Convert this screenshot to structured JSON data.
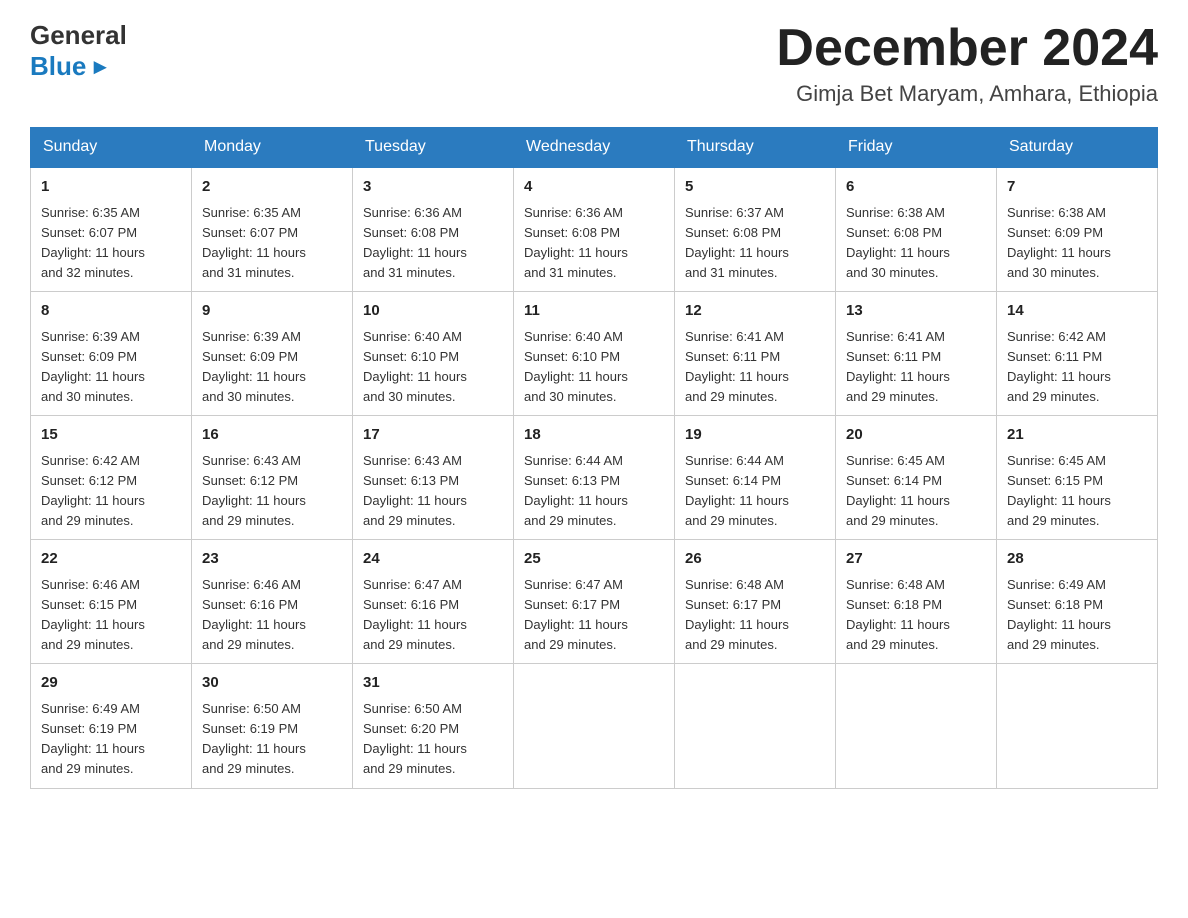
{
  "header": {
    "logo": {
      "general": "General",
      "blue": "Blue",
      "arrow": "▶"
    },
    "title": "December 2024",
    "location": "Gimja Bet Maryam, Amhara, Ethiopia"
  },
  "calendar": {
    "days_of_week": [
      "Sunday",
      "Monday",
      "Tuesday",
      "Wednesday",
      "Thursday",
      "Friday",
      "Saturday"
    ],
    "weeks": [
      [
        {
          "day": "1",
          "sunrise": "6:35 AM",
          "sunset": "6:07 PM",
          "daylight": "11 hours and 32 minutes."
        },
        {
          "day": "2",
          "sunrise": "6:35 AM",
          "sunset": "6:07 PM",
          "daylight": "11 hours and 31 minutes."
        },
        {
          "day": "3",
          "sunrise": "6:36 AM",
          "sunset": "6:08 PM",
          "daylight": "11 hours and 31 minutes."
        },
        {
          "day": "4",
          "sunrise": "6:36 AM",
          "sunset": "6:08 PM",
          "daylight": "11 hours and 31 minutes."
        },
        {
          "day": "5",
          "sunrise": "6:37 AM",
          "sunset": "6:08 PM",
          "daylight": "11 hours and 31 minutes."
        },
        {
          "day": "6",
          "sunrise": "6:38 AM",
          "sunset": "6:08 PM",
          "daylight": "11 hours and 30 minutes."
        },
        {
          "day": "7",
          "sunrise": "6:38 AM",
          "sunset": "6:09 PM",
          "daylight": "11 hours and 30 minutes."
        }
      ],
      [
        {
          "day": "8",
          "sunrise": "6:39 AM",
          "sunset": "6:09 PM",
          "daylight": "11 hours and 30 minutes."
        },
        {
          "day": "9",
          "sunrise": "6:39 AM",
          "sunset": "6:09 PM",
          "daylight": "11 hours and 30 minutes."
        },
        {
          "day": "10",
          "sunrise": "6:40 AM",
          "sunset": "6:10 PM",
          "daylight": "11 hours and 30 minutes."
        },
        {
          "day": "11",
          "sunrise": "6:40 AM",
          "sunset": "6:10 PM",
          "daylight": "11 hours and 30 minutes."
        },
        {
          "day": "12",
          "sunrise": "6:41 AM",
          "sunset": "6:11 PM",
          "daylight": "11 hours and 29 minutes."
        },
        {
          "day": "13",
          "sunrise": "6:41 AM",
          "sunset": "6:11 PM",
          "daylight": "11 hours and 29 minutes."
        },
        {
          "day": "14",
          "sunrise": "6:42 AM",
          "sunset": "6:11 PM",
          "daylight": "11 hours and 29 minutes."
        }
      ],
      [
        {
          "day": "15",
          "sunrise": "6:42 AM",
          "sunset": "6:12 PM",
          "daylight": "11 hours and 29 minutes."
        },
        {
          "day": "16",
          "sunrise": "6:43 AM",
          "sunset": "6:12 PM",
          "daylight": "11 hours and 29 minutes."
        },
        {
          "day": "17",
          "sunrise": "6:43 AM",
          "sunset": "6:13 PM",
          "daylight": "11 hours and 29 minutes."
        },
        {
          "day": "18",
          "sunrise": "6:44 AM",
          "sunset": "6:13 PM",
          "daylight": "11 hours and 29 minutes."
        },
        {
          "day": "19",
          "sunrise": "6:44 AM",
          "sunset": "6:14 PM",
          "daylight": "11 hours and 29 minutes."
        },
        {
          "day": "20",
          "sunrise": "6:45 AM",
          "sunset": "6:14 PM",
          "daylight": "11 hours and 29 minutes."
        },
        {
          "day": "21",
          "sunrise": "6:45 AM",
          "sunset": "6:15 PM",
          "daylight": "11 hours and 29 minutes."
        }
      ],
      [
        {
          "day": "22",
          "sunrise": "6:46 AM",
          "sunset": "6:15 PM",
          "daylight": "11 hours and 29 minutes."
        },
        {
          "day": "23",
          "sunrise": "6:46 AM",
          "sunset": "6:16 PM",
          "daylight": "11 hours and 29 minutes."
        },
        {
          "day": "24",
          "sunrise": "6:47 AM",
          "sunset": "6:16 PM",
          "daylight": "11 hours and 29 minutes."
        },
        {
          "day": "25",
          "sunrise": "6:47 AM",
          "sunset": "6:17 PM",
          "daylight": "11 hours and 29 minutes."
        },
        {
          "day": "26",
          "sunrise": "6:48 AM",
          "sunset": "6:17 PM",
          "daylight": "11 hours and 29 minutes."
        },
        {
          "day": "27",
          "sunrise": "6:48 AM",
          "sunset": "6:18 PM",
          "daylight": "11 hours and 29 minutes."
        },
        {
          "day": "28",
          "sunrise": "6:49 AM",
          "sunset": "6:18 PM",
          "daylight": "11 hours and 29 minutes."
        }
      ],
      [
        {
          "day": "29",
          "sunrise": "6:49 AM",
          "sunset": "6:19 PM",
          "daylight": "11 hours and 29 minutes."
        },
        {
          "day": "30",
          "sunrise": "6:50 AM",
          "sunset": "6:19 PM",
          "daylight": "11 hours and 29 minutes."
        },
        {
          "day": "31",
          "sunrise": "6:50 AM",
          "sunset": "6:20 PM",
          "daylight": "11 hours and 29 minutes."
        },
        null,
        null,
        null,
        null
      ]
    ],
    "labels": {
      "sunrise": "Sunrise:",
      "sunset": "Sunset:",
      "daylight": "Daylight:"
    }
  }
}
